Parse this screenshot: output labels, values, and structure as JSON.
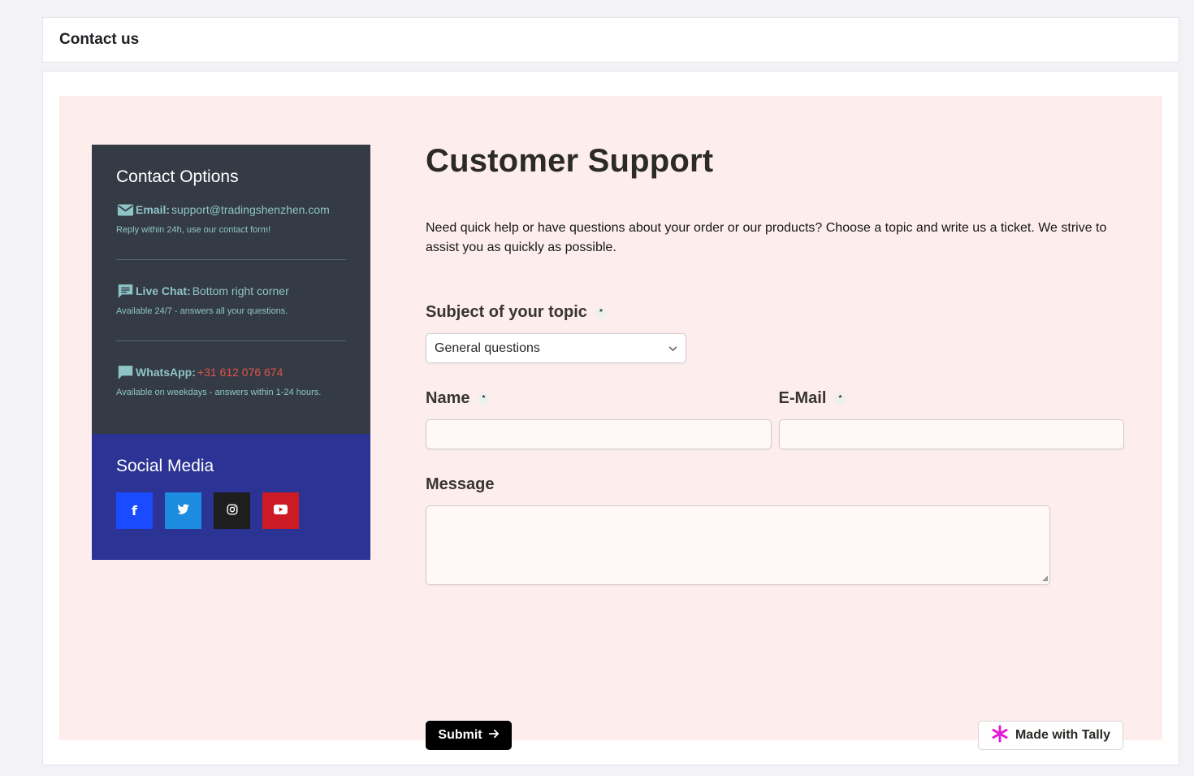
{
  "header": {
    "title": "Contact us"
  },
  "contact": {
    "title": "Contact Options",
    "items": [
      {
        "icon": "email-icon",
        "label": "Email:",
        "value": "support@tradingshenzhen.com",
        "note": "Reply within 24h, use our contact form!",
        "value_color": "#8fc4c6"
      },
      {
        "icon": "chat-icon",
        "label": "Live Chat:",
        "value": "Bottom right corner",
        "note": "Available 24/7 - answers all your questions.",
        "value_color": "#8fc4c6"
      },
      {
        "icon": "whatsapp-icon",
        "label": "WhatsApp:",
        "value": "+31 612 076 674",
        "note": "Available on weekdays - answers within 1-24 hours.",
        "value_color": "#e3524a"
      }
    ]
  },
  "social": {
    "title": "Social Media",
    "buttons": [
      {
        "name": "facebook",
        "glyph": "f",
        "color": "#1a4bff"
      },
      {
        "name": "twitter",
        "glyph": "t",
        "color": "#1d8ce0"
      },
      {
        "name": "instagram",
        "glyph": "◎",
        "color": "#1e1e1e"
      },
      {
        "name": "youtube",
        "glyph": "▶",
        "color": "#cc1b24"
      }
    ]
  },
  "form": {
    "title": "Customer Support",
    "description": "Need quick help or have questions about your order or our products? Choose a topic and write us a ticket. We strive to assist you as quickly as possible.",
    "subject_label": "Subject of your topic",
    "subject_value": "General questions",
    "name_label": "Name",
    "email_label": "E-Mail",
    "message_label": "Message",
    "required_mark": "*",
    "submit_label": "Submit",
    "tally_label": "Made with Tally"
  },
  "colors": {
    "page_bg": "#f3f3f7",
    "form_bg": "#fdeeed",
    "contact_panel": "#343b45",
    "social_panel": "#2b3394",
    "accent_text": "#8fc4c6",
    "tally_accent": "#e01cd5"
  }
}
